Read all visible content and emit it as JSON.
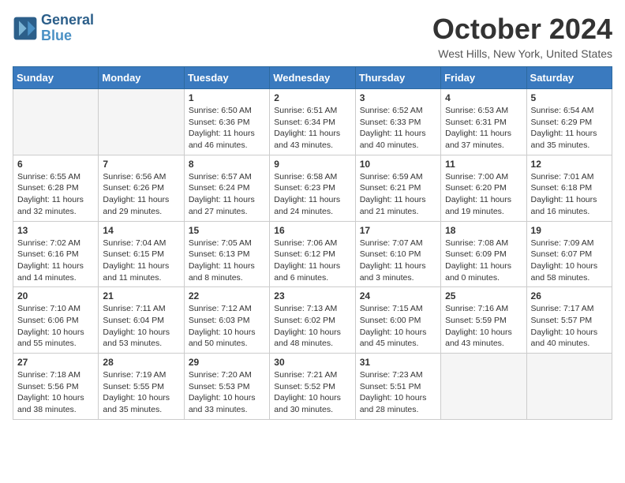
{
  "header": {
    "logo_line1": "General",
    "logo_line2": "Blue",
    "month_year": "October 2024",
    "location": "West Hills, New York, United States"
  },
  "weekdays": [
    "Sunday",
    "Monday",
    "Tuesday",
    "Wednesday",
    "Thursday",
    "Friday",
    "Saturday"
  ],
  "weeks": [
    [
      {
        "day": "",
        "text": ""
      },
      {
        "day": "",
        "text": ""
      },
      {
        "day": "1",
        "text": "Sunrise: 6:50 AM\nSunset: 6:36 PM\nDaylight: 11 hours and 46 minutes."
      },
      {
        "day": "2",
        "text": "Sunrise: 6:51 AM\nSunset: 6:34 PM\nDaylight: 11 hours and 43 minutes."
      },
      {
        "day": "3",
        "text": "Sunrise: 6:52 AM\nSunset: 6:33 PM\nDaylight: 11 hours and 40 minutes."
      },
      {
        "day": "4",
        "text": "Sunrise: 6:53 AM\nSunset: 6:31 PM\nDaylight: 11 hours and 37 minutes."
      },
      {
        "day": "5",
        "text": "Sunrise: 6:54 AM\nSunset: 6:29 PM\nDaylight: 11 hours and 35 minutes."
      }
    ],
    [
      {
        "day": "6",
        "text": "Sunrise: 6:55 AM\nSunset: 6:28 PM\nDaylight: 11 hours and 32 minutes."
      },
      {
        "day": "7",
        "text": "Sunrise: 6:56 AM\nSunset: 6:26 PM\nDaylight: 11 hours and 29 minutes."
      },
      {
        "day": "8",
        "text": "Sunrise: 6:57 AM\nSunset: 6:24 PM\nDaylight: 11 hours and 27 minutes."
      },
      {
        "day": "9",
        "text": "Sunrise: 6:58 AM\nSunset: 6:23 PM\nDaylight: 11 hours and 24 minutes."
      },
      {
        "day": "10",
        "text": "Sunrise: 6:59 AM\nSunset: 6:21 PM\nDaylight: 11 hours and 21 minutes."
      },
      {
        "day": "11",
        "text": "Sunrise: 7:00 AM\nSunset: 6:20 PM\nDaylight: 11 hours and 19 minutes."
      },
      {
        "day": "12",
        "text": "Sunrise: 7:01 AM\nSunset: 6:18 PM\nDaylight: 11 hours and 16 minutes."
      }
    ],
    [
      {
        "day": "13",
        "text": "Sunrise: 7:02 AM\nSunset: 6:16 PM\nDaylight: 11 hours and 14 minutes."
      },
      {
        "day": "14",
        "text": "Sunrise: 7:04 AM\nSunset: 6:15 PM\nDaylight: 11 hours and 11 minutes."
      },
      {
        "day": "15",
        "text": "Sunrise: 7:05 AM\nSunset: 6:13 PM\nDaylight: 11 hours and 8 minutes."
      },
      {
        "day": "16",
        "text": "Sunrise: 7:06 AM\nSunset: 6:12 PM\nDaylight: 11 hours and 6 minutes."
      },
      {
        "day": "17",
        "text": "Sunrise: 7:07 AM\nSunset: 6:10 PM\nDaylight: 11 hours and 3 minutes."
      },
      {
        "day": "18",
        "text": "Sunrise: 7:08 AM\nSunset: 6:09 PM\nDaylight: 11 hours and 0 minutes."
      },
      {
        "day": "19",
        "text": "Sunrise: 7:09 AM\nSunset: 6:07 PM\nDaylight: 10 hours and 58 minutes."
      }
    ],
    [
      {
        "day": "20",
        "text": "Sunrise: 7:10 AM\nSunset: 6:06 PM\nDaylight: 10 hours and 55 minutes."
      },
      {
        "day": "21",
        "text": "Sunrise: 7:11 AM\nSunset: 6:04 PM\nDaylight: 10 hours and 53 minutes."
      },
      {
        "day": "22",
        "text": "Sunrise: 7:12 AM\nSunset: 6:03 PM\nDaylight: 10 hours and 50 minutes."
      },
      {
        "day": "23",
        "text": "Sunrise: 7:13 AM\nSunset: 6:02 PM\nDaylight: 10 hours and 48 minutes."
      },
      {
        "day": "24",
        "text": "Sunrise: 7:15 AM\nSunset: 6:00 PM\nDaylight: 10 hours and 45 minutes."
      },
      {
        "day": "25",
        "text": "Sunrise: 7:16 AM\nSunset: 5:59 PM\nDaylight: 10 hours and 43 minutes."
      },
      {
        "day": "26",
        "text": "Sunrise: 7:17 AM\nSunset: 5:57 PM\nDaylight: 10 hours and 40 minutes."
      }
    ],
    [
      {
        "day": "27",
        "text": "Sunrise: 7:18 AM\nSunset: 5:56 PM\nDaylight: 10 hours and 38 minutes."
      },
      {
        "day": "28",
        "text": "Sunrise: 7:19 AM\nSunset: 5:55 PM\nDaylight: 10 hours and 35 minutes."
      },
      {
        "day": "29",
        "text": "Sunrise: 7:20 AM\nSunset: 5:53 PM\nDaylight: 10 hours and 33 minutes."
      },
      {
        "day": "30",
        "text": "Sunrise: 7:21 AM\nSunset: 5:52 PM\nDaylight: 10 hours and 30 minutes."
      },
      {
        "day": "31",
        "text": "Sunrise: 7:23 AM\nSunset: 5:51 PM\nDaylight: 10 hours and 28 minutes."
      },
      {
        "day": "",
        "text": ""
      },
      {
        "day": "",
        "text": ""
      }
    ]
  ]
}
